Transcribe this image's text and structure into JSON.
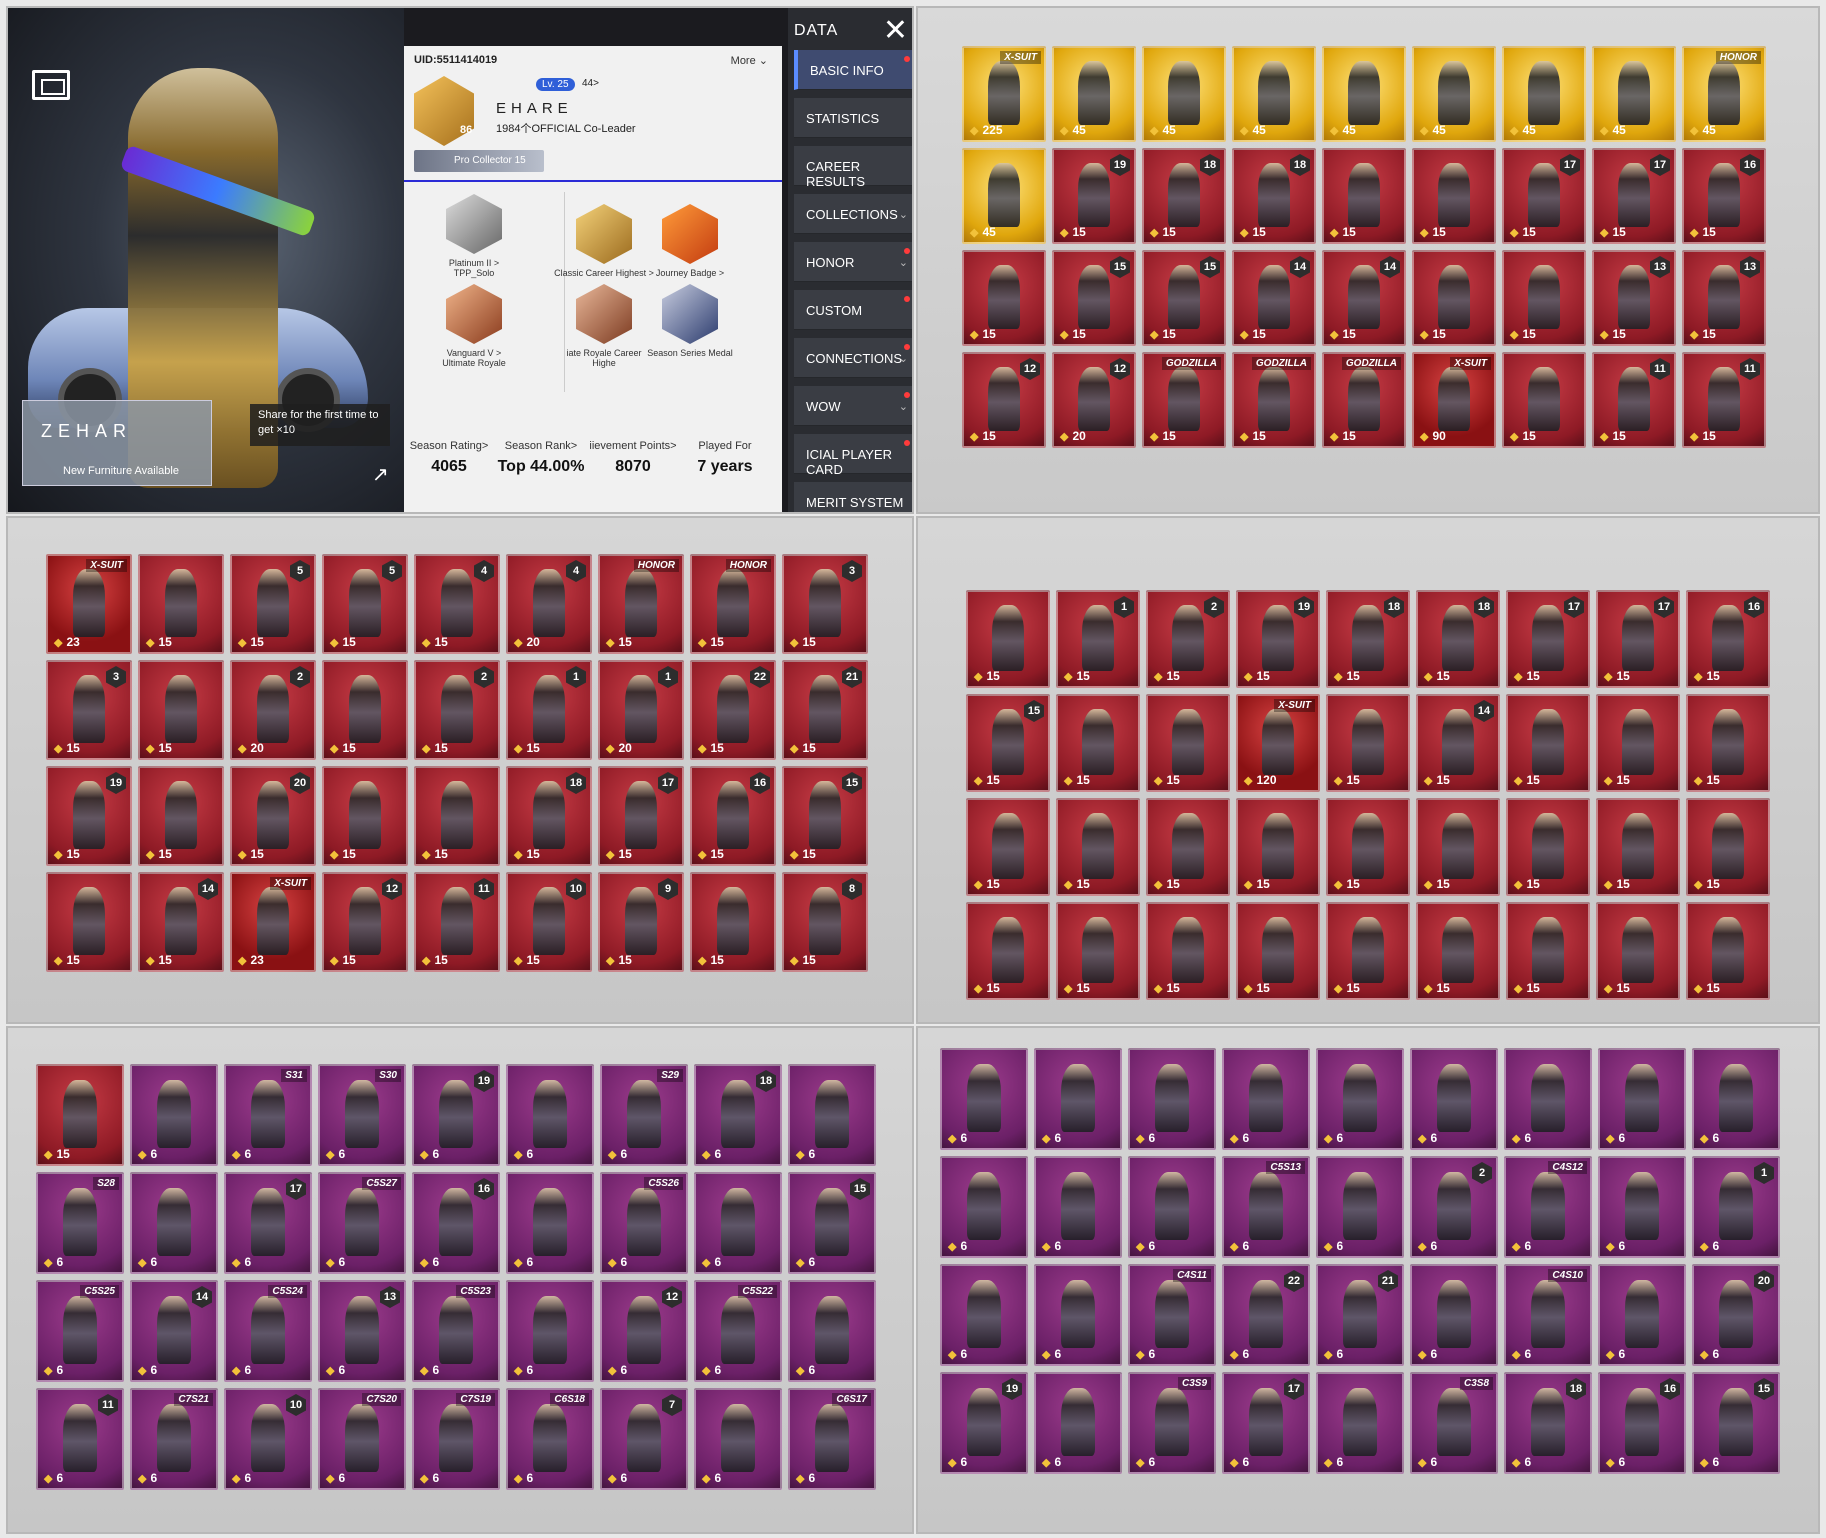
{
  "profile": {
    "uid": "UID:5511414019",
    "more": "More",
    "level_badge": "Lv. 25",
    "likes": "44>",
    "rank_level": "86",
    "season_tag": "S15",
    "player_name": "EHARE",
    "clan": "1984个OFFICIAL  Co-Leader",
    "collector": "Pro Collector 15",
    "home_name": "ZEHAR",
    "home_sub": "New Furniture Available",
    "share_tip": "Share for the first time to get",
    "share_reward": "×10",
    "medals": [
      {
        "title": "Platinum II >",
        "sub": "TPP_Solo"
      },
      {
        "title": "Classic Career Highest >",
        "sub": ""
      },
      {
        "title": "Journey Badge >",
        "sub": ""
      },
      {
        "title": "Vanguard V >",
        "sub": "Ultimate Royale"
      },
      {
        "title": "iate Royale Career Highe",
        "sub": ""
      },
      {
        "title": "Season Series Medal",
        "sub": ""
      }
    ],
    "stats": [
      {
        "label": "Season Rating>",
        "value": "4065"
      },
      {
        "label": "Season Rank>",
        "value": "Top 44.00%"
      },
      {
        "label": "iievement Points>",
        "value": "8070"
      },
      {
        "label": "Played For",
        "value": "7 years"
      }
    ]
  },
  "menu": {
    "title": "DATA",
    "items": [
      "BASIC INFO",
      "STATISTICS",
      "CAREER RESULTS",
      "COLLECTIONS",
      "HONOR",
      "CUSTOM",
      "CONNECTIONS",
      "WOW",
      "ICIAL PLAYER CARD",
      "MERIT SYSTEM"
    ]
  },
  "grids": {
    "p2": [
      [
        "gold",
        "X-SUIT",
        "225"
      ],
      [
        "gold",
        "",
        "45"
      ],
      [
        "gold",
        "",
        "45"
      ],
      [
        "gold",
        "",
        "45"
      ],
      [
        "gold",
        "",
        "45"
      ],
      [
        "gold",
        "",
        "45"
      ],
      [
        "gold",
        "",
        "45"
      ],
      [
        "gold",
        "",
        "45"
      ],
      [
        "gold",
        "HONOR",
        "45"
      ],
      [
        "gold",
        "",
        "45"
      ],
      [
        "red",
        "19",
        "15"
      ],
      [
        "red",
        "18",
        "15"
      ],
      [
        "red",
        "18",
        "15"
      ],
      [
        "red",
        "",
        "15"
      ],
      [
        "red",
        "",
        "15"
      ],
      [
        "red",
        "17",
        "15"
      ],
      [
        "red",
        "17",
        "15"
      ],
      [
        "red",
        "16",
        "15"
      ],
      [
        "red",
        "",
        "15"
      ],
      [
        "red",
        "15",
        "15"
      ],
      [
        "red",
        "15",
        "15"
      ],
      [
        "red",
        "14",
        "15"
      ],
      [
        "red",
        "14",
        "15"
      ],
      [
        "red",
        "",
        "15"
      ],
      [
        "red",
        "",
        "15"
      ],
      [
        "red",
        "13",
        "15"
      ],
      [
        "red",
        "13",
        "15"
      ],
      [
        "red",
        "12",
        "15"
      ],
      [
        "red",
        "12",
        "20"
      ],
      [
        "red",
        "GODZILLA",
        "15"
      ],
      [
        "red",
        "GODZILLA",
        "15"
      ],
      [
        "red",
        "GODZILLA",
        "15"
      ],
      [
        "xsuit",
        "X-SUIT",
        "90"
      ],
      [
        "red",
        "",
        "15"
      ],
      [
        "red",
        "11",
        "15"
      ],
      [
        "red",
        "11",
        "15"
      ]
    ],
    "p3": [
      [
        "xsuit",
        "X-SUIT",
        "23"
      ],
      [
        "red",
        "",
        "15"
      ],
      [
        "red",
        "5",
        "15"
      ],
      [
        "red",
        "5",
        "15"
      ],
      [
        "red",
        "4",
        "15"
      ],
      [
        "red",
        "4",
        "20"
      ],
      [
        "red",
        "HONOR",
        "15"
      ],
      [
        "red",
        "HONOR",
        "15"
      ],
      [
        "red",
        "3",
        "15"
      ],
      [
        "red",
        "3",
        "15"
      ],
      [
        "red",
        "",
        "15"
      ],
      [
        "red",
        "2",
        "20"
      ],
      [
        "red",
        "",
        "15"
      ],
      [
        "red",
        "2",
        "15"
      ],
      [
        "red",
        "1",
        "15"
      ],
      [
        "red",
        "1",
        "20"
      ],
      [
        "red",
        "22",
        "15"
      ],
      [
        "red",
        "21",
        "15"
      ],
      [
        "red",
        "19",
        "15"
      ],
      [
        "red",
        "",
        "15"
      ],
      [
        "red",
        "20",
        "15"
      ],
      [
        "red",
        "",
        "15"
      ],
      [
        "red",
        "",
        "15"
      ],
      [
        "red",
        "18",
        "15"
      ],
      [
        "red",
        "17",
        "15"
      ],
      [
        "red",
        "16",
        "15"
      ],
      [
        "red",
        "15",
        "15"
      ],
      [
        "red",
        "",
        "15"
      ],
      [
        "red",
        "14",
        "15"
      ],
      [
        "xsuit",
        "X-SUIT",
        "23"
      ],
      [
        "red",
        "12",
        "15"
      ],
      [
        "red",
        "11",
        "15"
      ],
      [
        "red",
        "10",
        "15"
      ],
      [
        "red",
        "9",
        "15"
      ],
      [
        "red",
        "",
        "15"
      ],
      [
        "red",
        "8",
        "15"
      ]
    ],
    "p4": [
      [
        "red",
        "",
        "15"
      ],
      [
        "red",
        "1",
        "15"
      ],
      [
        "red",
        "2",
        "15"
      ],
      [
        "red",
        "19",
        "15"
      ],
      [
        "red",
        "18",
        "15"
      ],
      [
        "red",
        "18",
        "15"
      ],
      [
        "red",
        "17",
        "15"
      ],
      [
        "red",
        "17",
        "15"
      ],
      [
        "red",
        "16",
        "15"
      ],
      [
        "red",
        "15",
        "15"
      ],
      [
        "red",
        "",
        "15"
      ],
      [
        "red",
        "",
        "15"
      ],
      [
        "xsuit",
        "X-SUIT",
        "120"
      ],
      [
        "red",
        "",
        "15"
      ],
      [
        "red",
        "14",
        "15"
      ],
      [
        "red",
        "",
        "15"
      ],
      [
        "red",
        "",
        "15"
      ],
      [
        "red",
        "",
        "15"
      ],
      [
        "red",
        "",
        "15"
      ],
      [
        "red",
        "",
        "15"
      ],
      [
        "red",
        "",
        "15"
      ],
      [
        "red",
        "",
        "15"
      ],
      [
        "red",
        "",
        "15"
      ],
      [
        "red",
        "",
        "15"
      ],
      [
        "red",
        "",
        "15"
      ],
      [
        "red",
        "",
        "15"
      ],
      [
        "red",
        "",
        "15"
      ],
      [
        "red",
        "",
        "15"
      ],
      [
        "red",
        "",
        "15"
      ],
      [
        "red",
        "",
        "15"
      ],
      [
        "red",
        "",
        "15"
      ],
      [
        "red",
        "",
        "15"
      ],
      [
        "red",
        "",
        "15"
      ],
      [
        "red",
        "",
        "15"
      ],
      [
        "red",
        "",
        "15"
      ],
      [
        "red",
        "",
        "15"
      ]
    ],
    "p5": [
      [
        "red",
        "",
        "15"
      ],
      [
        "purple",
        "",
        "6"
      ],
      [
        "purple",
        "S31",
        "6"
      ],
      [
        "purple",
        "S30",
        "6"
      ],
      [
        "purple",
        "19",
        "6"
      ],
      [
        "purple",
        "",
        "6"
      ],
      [
        "purple",
        "S29",
        "6"
      ],
      [
        "purple",
        "18",
        "6"
      ],
      [
        "purple",
        "",
        "6"
      ],
      [
        "purple",
        "S28",
        "6"
      ],
      [
        "purple",
        "",
        "6"
      ],
      [
        "purple",
        "17",
        "6"
      ],
      [
        "purple",
        "C5S27",
        "6"
      ],
      [
        "purple",
        "16",
        "6"
      ],
      [
        "purple",
        "",
        "6"
      ],
      [
        "purple",
        "C5S26",
        "6"
      ],
      [
        "purple",
        "",
        "6"
      ],
      [
        "purple",
        "15",
        "6"
      ],
      [
        "purple",
        "C5S25",
        "6"
      ],
      [
        "purple",
        "14",
        "6"
      ],
      [
        "purple",
        "C5S24",
        "6"
      ],
      [
        "purple",
        "13",
        "6"
      ],
      [
        "purple",
        "C5S23",
        "6"
      ],
      [
        "purple",
        "",
        "6"
      ],
      [
        "purple",
        "12",
        "6"
      ],
      [
        "purple",
        "C5S22",
        "6"
      ],
      [
        "purple",
        "",
        "6"
      ],
      [
        "purple",
        "11",
        "6"
      ],
      [
        "purple",
        "C7S21",
        "6"
      ],
      [
        "purple",
        "10",
        "6"
      ],
      [
        "purple",
        "C7S20",
        "6"
      ],
      [
        "purple",
        "C7S19",
        "6"
      ],
      [
        "purple",
        "C6S18",
        "6"
      ],
      [
        "purple",
        "7",
        "6"
      ],
      [
        "purple",
        "",
        "6"
      ],
      [
        "purple",
        "C6S17",
        "6"
      ]
    ],
    "p6": [
      [
        "purple",
        "",
        "6"
      ],
      [
        "purple",
        "",
        "6"
      ],
      [
        "purple",
        "",
        "6"
      ],
      [
        "purple",
        "",
        "6"
      ],
      [
        "purple",
        "",
        "6"
      ],
      [
        "purple",
        "",
        "6"
      ],
      [
        "purple",
        "",
        "6"
      ],
      [
        "purple",
        "",
        "6"
      ],
      [
        "purple",
        "",
        "6"
      ],
      [
        "purple",
        "",
        "6"
      ],
      [
        "purple",
        "",
        "6"
      ],
      [
        "purple",
        "",
        "6"
      ],
      [
        "purple",
        "C5S13",
        "6"
      ],
      [
        "purple",
        "",
        "6"
      ],
      [
        "purple",
        "2",
        "6"
      ],
      [
        "purple",
        "C4S12",
        "6"
      ],
      [
        "purple",
        "",
        "6"
      ],
      [
        "purple",
        "1",
        "6"
      ],
      [
        "purple",
        "",
        "6"
      ],
      [
        "purple",
        "",
        "6"
      ],
      [
        "purple",
        "C4S11",
        "6"
      ],
      [
        "purple",
        "22",
        "6"
      ],
      [
        "purple",
        "21",
        "6"
      ],
      [
        "purple",
        "",
        "6"
      ],
      [
        "purple",
        "C4S10",
        "6"
      ],
      [
        "purple",
        "",
        "6"
      ],
      [
        "purple",
        "20",
        "6"
      ],
      [
        "purple",
        "19",
        "6"
      ],
      [
        "purple",
        "",
        "6"
      ],
      [
        "purple",
        "C3S9",
        "6"
      ],
      [
        "purple",
        "17",
        "6"
      ],
      [
        "purple",
        "",
        "6"
      ],
      [
        "purple",
        "C3S8",
        "6"
      ],
      [
        "purple",
        "18",
        "6"
      ],
      [
        "purple",
        "16",
        "6"
      ],
      [
        "purple",
        "15",
        "6"
      ]
    ]
  }
}
